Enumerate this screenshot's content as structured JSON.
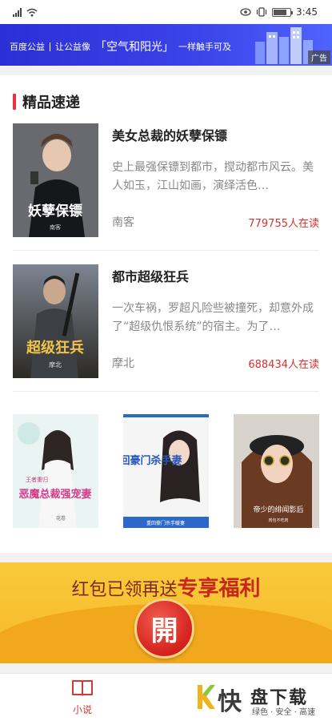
{
  "status_bar": {
    "time": "3:45",
    "battery_level": 0.8
  },
  "banner": {
    "org": "百度公益",
    "slogan_pre": "让公益像",
    "slogan_highlight": "「空气和阳光」",
    "slogan_post": "一样触手可及",
    "ad_label": "广告",
    "color": "#3b44e8"
  },
  "section": {
    "title": "精品速递",
    "accent_color": "#e8323f"
  },
  "books": [
    {
      "title": "美女总裁的妖孽保镖",
      "description": "史上最强保镖到都市，搅动都市风云。美人如玉，江山如画，演绎活色…",
      "author": "南客",
      "readers": "779755人在读",
      "cover_title": "妖孽保镖",
      "cover_author": "南客"
    },
    {
      "title": "都市超级狂兵",
      "description": "一次车祸，罗超凡险些被撞死，却意外成了“超级仇恨系统”的宿主。为了…",
      "author": "摩北",
      "readers": "688434人在读",
      "cover_title": "超级狂兵",
      "cover_author": "摩北"
    }
  ],
  "grid_books": [
    {
      "cover_title": "恶魔总裁强宠妻",
      "cover_badge": "王者重归",
      "cover_author": "花卷"
    },
    {
      "cover_title": "重回豪门杀手妻",
      "cover_sub": "重回豪门杀手暖妻"
    },
    {
      "cover_title": "帝少的绯闻影后",
      "cover_author": "肉包不吃肉"
    }
  ],
  "promo": {
    "text_small": "红包已领再送",
    "text_big": "专享福利",
    "button_label": "開"
  },
  "bottom_nav": {
    "items": [
      {
        "label": "小说",
        "icon": "book-icon",
        "active": true
      }
    ],
    "active_color": "#d23a3a"
  },
  "watermark": {
    "k": "K",
    "kuai": "快",
    "pan": "盘下载",
    "slogan": "绿色 · 安全 · 高速"
  }
}
